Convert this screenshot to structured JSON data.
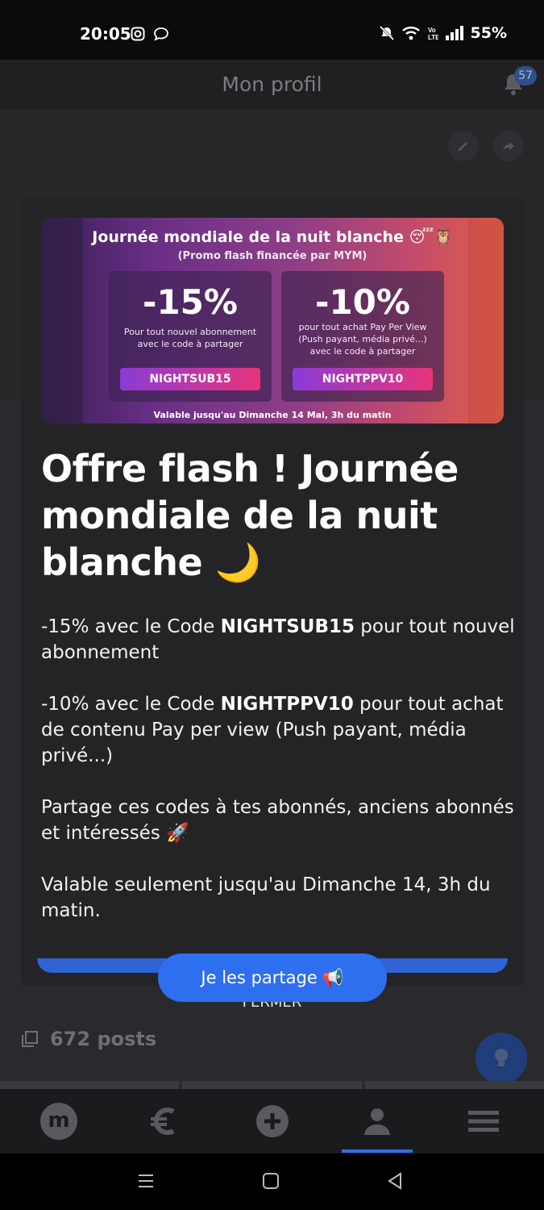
{
  "status_bar": {
    "time": "20:05",
    "battery": "55%",
    "icons": [
      "instagram-icon",
      "message-icon",
      "mute-icon",
      "wifi-icon",
      "volte-icon",
      "signal-icon"
    ]
  },
  "header": {
    "title": "Mon profil",
    "notification_count": "57"
  },
  "banner": {
    "title": "Journée mondiale de la nuit blanche 😴🦉",
    "subtitle": "(Promo flash financée par MYM)",
    "offers": [
      {
        "percent": "-15%",
        "description": "Pour tout nouvel abonnement avec le code à partager",
        "code": "NIGHTSUB15"
      },
      {
        "percent": "-10%",
        "description": "pour tout achat Pay Per View (Push payant, média privé...) avec le code à partager",
        "code": "NIGHTPPV10"
      }
    ],
    "validity": "Valable jusqu'au Dimanche 14 Mai, 3h du matin"
  },
  "modal": {
    "headline": "Offre flash ! Journée mondiale de la nuit blanche 🌙",
    "para1": {
      "prefix": "-15% avec le Code ",
      "code": "NIGHTSUB15",
      "suffix": " pour tout nouvel abonnement"
    },
    "para2": {
      "prefix": "-10% avec le Code ",
      "code": "NIGHTPPV10",
      "suffix": " pour tout achat de contenu Pay per view (Push payant, média privé...)"
    },
    "para3": "Partage ces codes à tes abonnés, anciens abonnés et intéressés 🚀",
    "para4": "Valable seulement jusqu'au Dimanche 14, 3h du matin.",
    "share_button": "Je les partage 📢",
    "close_button": "FERMER"
  },
  "profile": {
    "posts_count": "672 posts"
  },
  "bottom_nav": {
    "items": [
      "home-logo",
      "earnings",
      "create",
      "profile",
      "menu"
    ],
    "home_logo_letter": "m",
    "active": "profile"
  },
  "colors": {
    "accent": "#2e6ff0",
    "background": "#242427"
  }
}
